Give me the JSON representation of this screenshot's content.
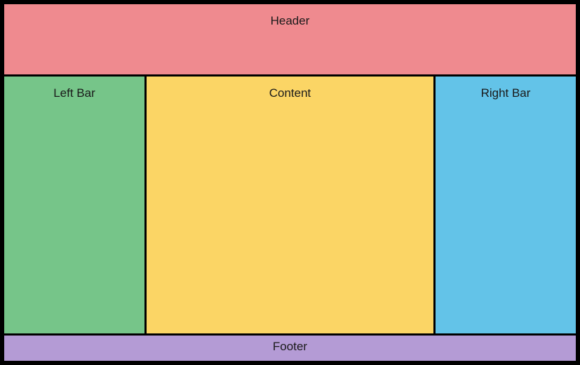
{
  "layout": {
    "header": "Header",
    "left": "Left Bar",
    "content": "Content",
    "right": "Right Bar",
    "footer": "Footer"
  },
  "colors": {
    "header": "#ef8a8f",
    "left": "#76c589",
    "content": "#fbd565",
    "right": "#63c3e8",
    "footer": "#b49bd5",
    "background": "#000000"
  }
}
